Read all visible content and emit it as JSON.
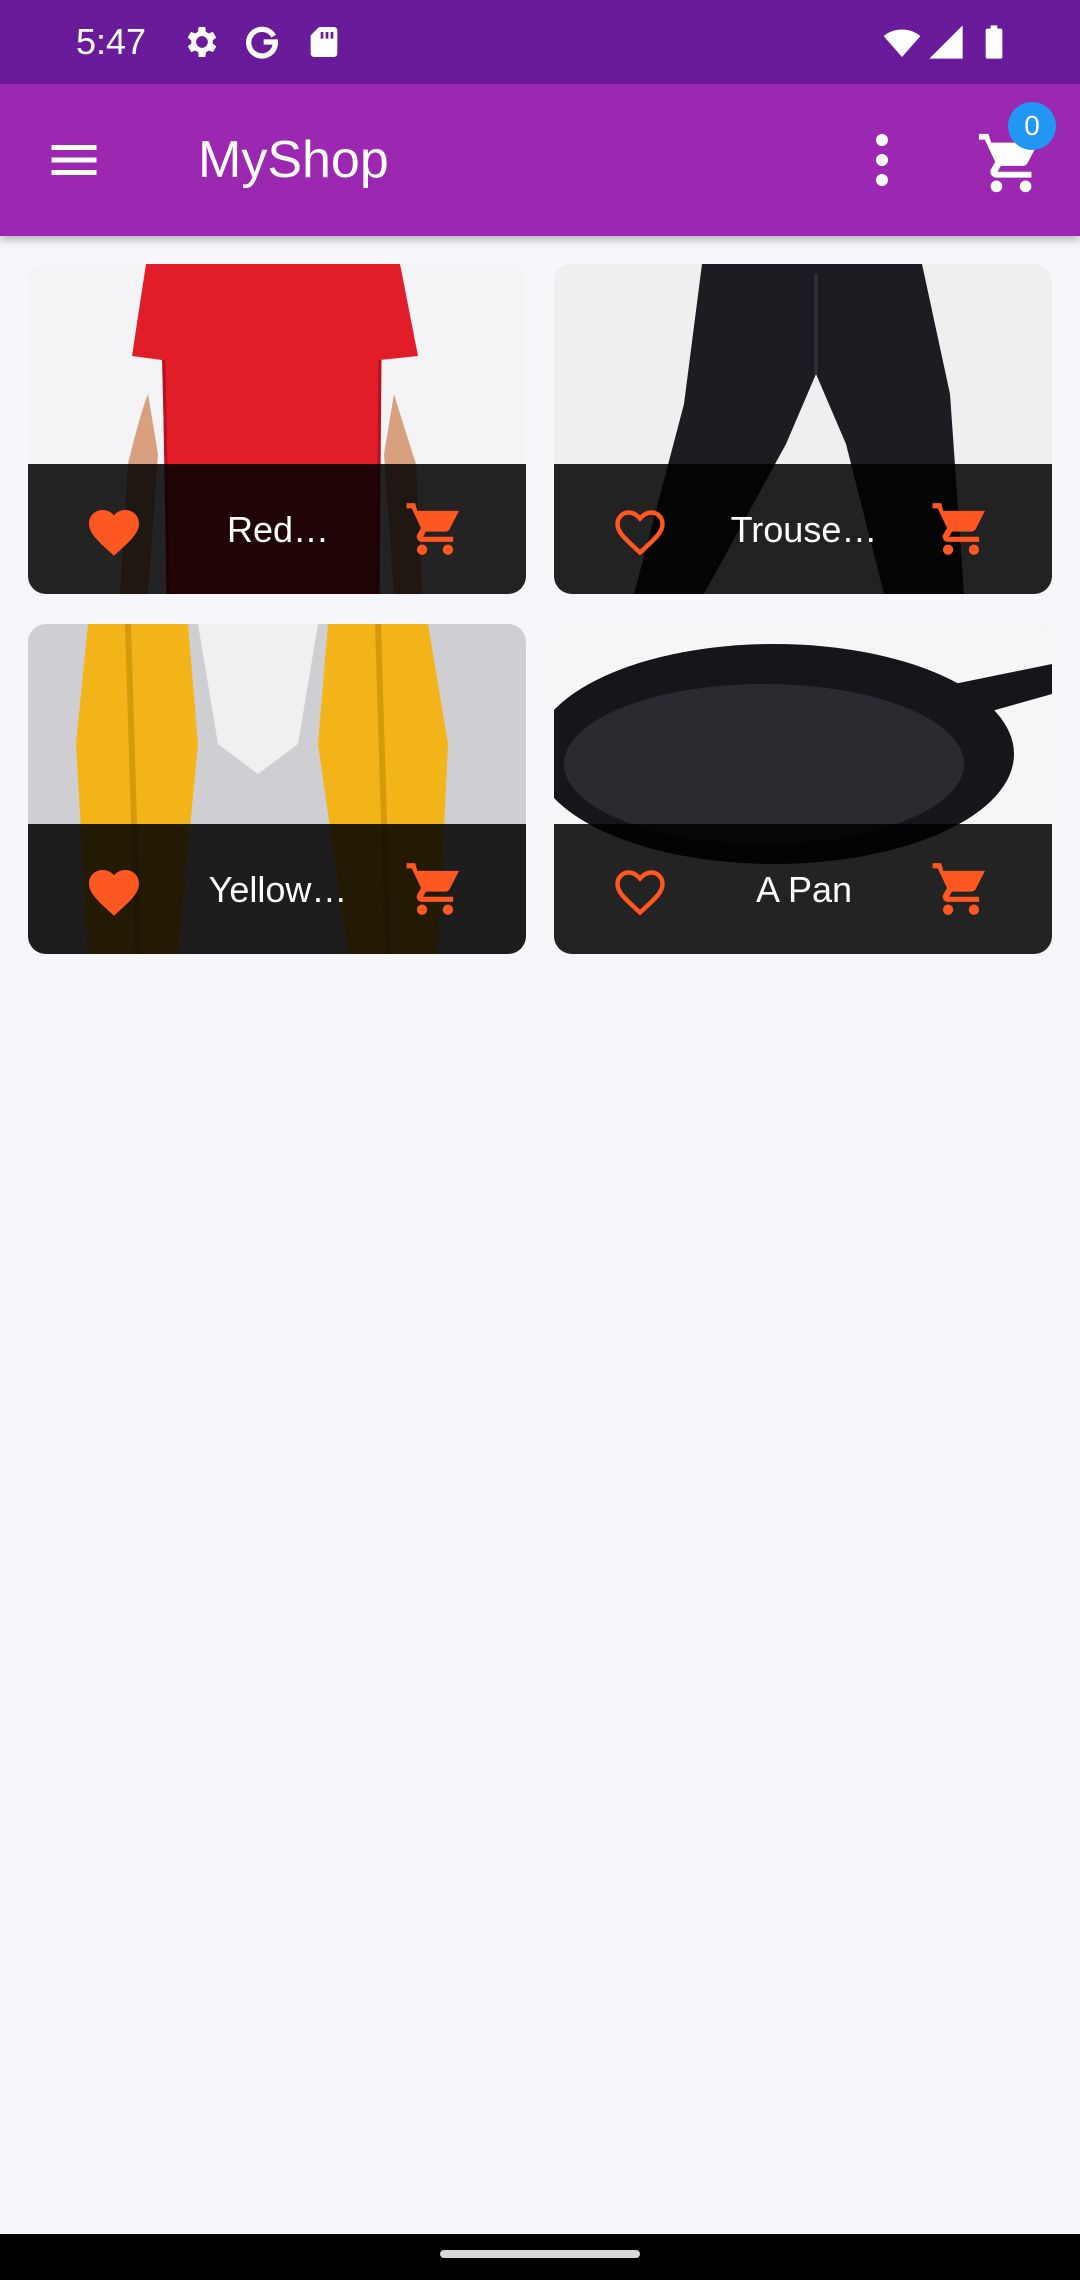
{
  "status_bar": {
    "time": "5:47",
    "icons": [
      "settings-gear-icon",
      "google-g-icon",
      "sd-card-icon",
      "wifi-icon",
      "cell-signal-icon",
      "battery-icon"
    ]
  },
  "app_bar": {
    "title": "MyShop",
    "menu_icon": "hamburger-menu-icon",
    "more_icon": "more-vert-icon",
    "cart_icon": "shopping-cart-icon",
    "cart_count": "0",
    "colors": {
      "status_bar": "#6a1b9a",
      "app_bar": "#9c27b0",
      "badge": "#2196f3"
    }
  },
  "products": [
    {
      "title": "Red…",
      "favorite": true,
      "image": "red-shirt"
    },
    {
      "title": "Trouse…",
      "favorite": false,
      "image": "trousers"
    },
    {
      "title": "Yellow…",
      "favorite": true,
      "image": "yellow-scarf"
    },
    {
      "title": "A Pan",
      "favorite": false,
      "image": "pan"
    }
  ],
  "accent_color": "#ff5722"
}
